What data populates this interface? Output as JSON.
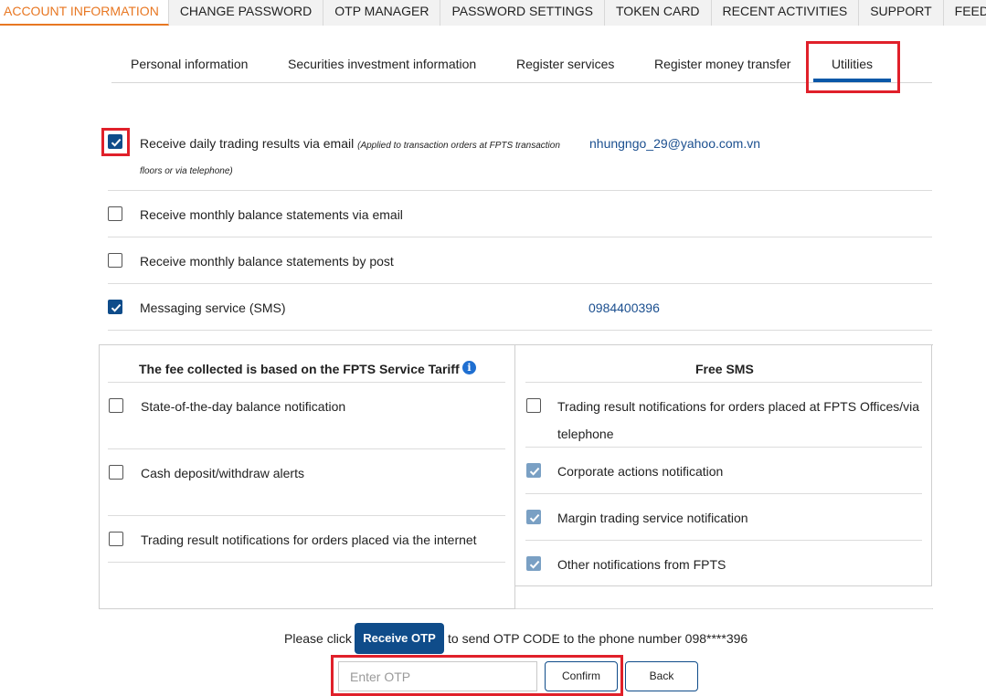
{
  "topnav": {
    "items": [
      {
        "label": "ACCOUNT INFORMATION",
        "active": true
      },
      {
        "label": "CHANGE PASSWORD"
      },
      {
        "label": "OTP MANAGER"
      },
      {
        "label": "PASSWORD SETTINGS"
      },
      {
        "label": "TOKEN CARD"
      },
      {
        "label": "RECENT ACTIVITIES"
      },
      {
        "label": "SUPPORT"
      },
      {
        "label": "FEEDBACK"
      }
    ]
  },
  "subtabs": {
    "personal": "Personal information",
    "securities": "Securities investment information",
    "register_services": "Register services",
    "money_transfer": "Register money transfer",
    "utilities": "Utilities"
  },
  "utilities": {
    "daily_email": {
      "label": "Receive daily trading results via email",
      "note_line1": "(Applied to transaction orders at FPTS transaction",
      "note_line2": "floors or via telephone)",
      "value": "nhungngo_29@yahoo.com.vn",
      "checked": true
    },
    "monthly_email": {
      "label": "Receive monthly balance statements via email",
      "checked": false
    },
    "monthly_post": {
      "label": "Receive monthly balance statements by post",
      "checked": false
    },
    "sms": {
      "label": "Messaging service (SMS)",
      "value": "0984400396",
      "checked": true
    }
  },
  "fee_panel": {
    "title": "The fee collected is based on the FPTS Service Tariff",
    "items": [
      {
        "label": "State-of-the-day balance notification",
        "checked": false
      },
      {
        "label": "Cash deposit/withdraw alerts",
        "checked": false
      },
      {
        "label": "Trading result notifications for orders placed via the internet",
        "checked": false
      }
    ]
  },
  "free_panel": {
    "title": "Free SMS",
    "items": [
      {
        "label_line1": "Trading result notifications for orders placed at FPTS Offices/via",
        "label_line2": "telephone",
        "checked": false
      },
      {
        "label": "Corporate actions notification",
        "checked": true,
        "disabled": true
      },
      {
        "label": "Margin trading service notification",
        "checked": true,
        "disabled": true
      },
      {
        "label": "Other notifications from FPTS",
        "checked": true,
        "disabled": true
      }
    ]
  },
  "otp": {
    "prefix": "Please click",
    "receive_button": "Receive OTP",
    "suffix": "to send OTP CODE to the phone number 098****396",
    "placeholder": "Enter OTP",
    "confirm": "Confirm",
    "back": "Back"
  },
  "colors": {
    "accent_orange": "#e87722",
    "primary_blue": "#0f4c8a",
    "highlight_red": "#e0202a"
  }
}
